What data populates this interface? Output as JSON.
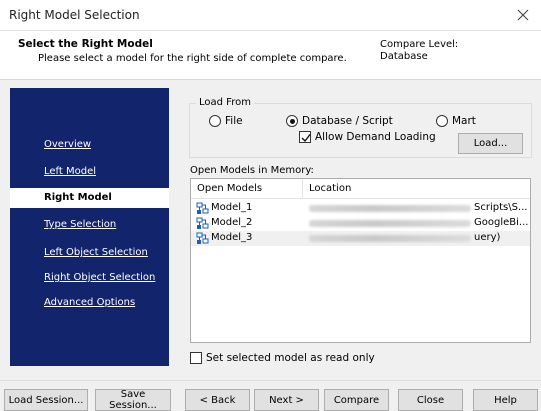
{
  "window": {
    "title": "Right Model Selection"
  },
  "header": {
    "title": "Select the Right Model",
    "subtitle": "Please select a model for the right side of complete compare.",
    "compare_level_label": "Compare Level:",
    "compare_level_value": "Database"
  },
  "nav": {
    "items": [
      {
        "label": "Overview",
        "active": false
      },
      {
        "label": "Left Model",
        "active": false
      },
      {
        "label": "Right Model",
        "active": true
      },
      {
        "label": "Type Selection",
        "active": false
      },
      {
        "label": "Left Object Selection",
        "active": false
      },
      {
        "label": "Right Object Selection",
        "active": false
      },
      {
        "label": "Advanced Options",
        "active": false
      }
    ]
  },
  "load_from": {
    "legend": "Load From",
    "options": [
      {
        "label": "File",
        "selected": false
      },
      {
        "label": "Database / Script",
        "selected": true
      },
      {
        "label": "Mart",
        "selected": false
      }
    ],
    "allow_demand_loading": {
      "label": "Allow Demand Loading",
      "checked": true
    },
    "load_button": "Load..."
  },
  "open_models": {
    "label": "Open Models in Memory:",
    "columns": [
      "Open Models",
      "Location"
    ],
    "rows": [
      {
        "name": "Model_1",
        "location_suffix": "Scripts\\S...",
        "selected": false
      },
      {
        "name": "Model_2",
        "location_suffix": "GoogleBi...",
        "selected": false
      },
      {
        "name": "Model_3",
        "location_suffix": "uery)",
        "selected": true
      }
    ]
  },
  "read_only": {
    "label": "Set selected model as read only",
    "checked": false
  },
  "buttons": {
    "load_session": "Load Session...",
    "save_session": "Save Session...",
    "back": "< Back",
    "next": "Next >",
    "compare": "Compare",
    "close": "Close",
    "help": "Help"
  },
  "colors": {
    "nav_bg": "#12246b",
    "model_icon": "#1b5fb5"
  }
}
